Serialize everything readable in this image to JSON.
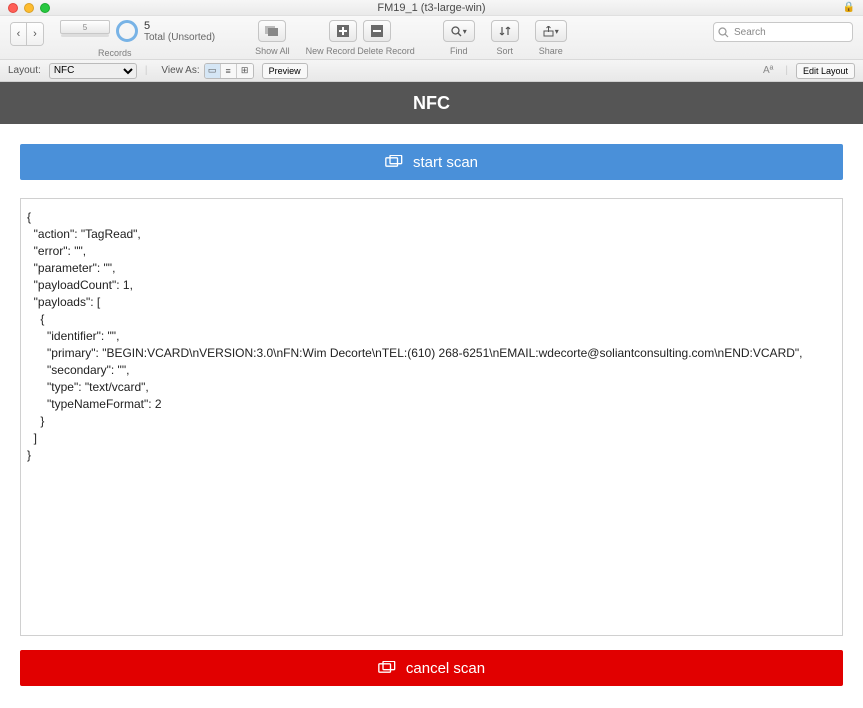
{
  "titlebar": {
    "title": "FM19_1 (t3-large-win)"
  },
  "toolbar": {
    "records_label": "Records",
    "slider_value": "5",
    "total_count": "5",
    "total_status": "Total (Unsorted)",
    "showall": "Show All",
    "newrecord": "New Record",
    "deleterecord": "Delete Record",
    "find": "Find",
    "sort": "Sort",
    "share": "Share",
    "search_placeholder": "Search"
  },
  "layoutbar": {
    "layout_label": "Layout:",
    "layout_value": "NFC",
    "viewas_label": "View As:",
    "preview": "Preview",
    "editlayout": "Edit Layout"
  },
  "header": {
    "title": "NFC"
  },
  "buttons": {
    "start": "start scan",
    "cancel": "cancel scan"
  },
  "result_text": "{\n  \"action\": \"TagRead\",\n  \"error\": \"\",\n  \"parameter\": \"\",\n  \"payloadCount\": 1,\n  \"payloads\": [\n    {\n      \"identifier\": \"\",\n      \"primary\": \"BEGIN:VCARD\\nVERSION:3.0\\nFN:Wim Decorte\\nTEL:(610) 268-6251\\nEMAIL:wdecorte@soliantconsulting.com\\nEND:VCARD\",\n      \"secondary\": \"\",\n      \"type\": \"text/vcard\",\n      \"typeNameFormat\": 2\n    }\n  ]\n}"
}
